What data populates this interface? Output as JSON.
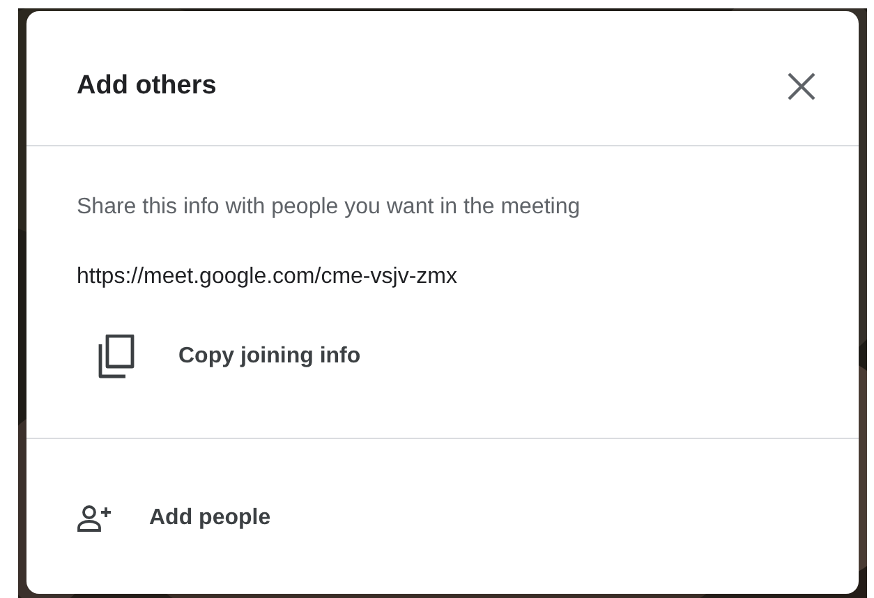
{
  "dialog": {
    "title": "Add others",
    "message": "Share this info with people you want in the meeting",
    "link": "https://meet.google.com/cme-vsjv-zmx",
    "actions": [
      {
        "kind": "copy",
        "label": "Copy joining info"
      },
      {
        "kind": "add-person",
        "label": "Add people"
      }
    ]
  }
}
